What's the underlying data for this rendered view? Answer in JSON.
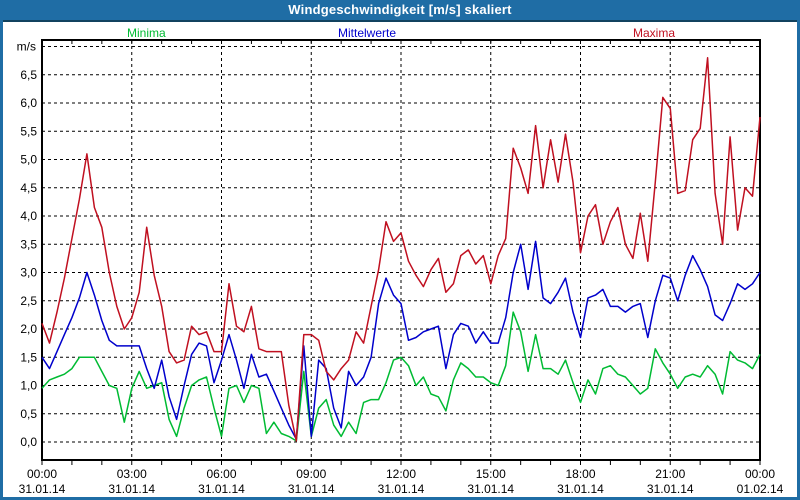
{
  "header": {
    "title": "Windgeschwindigkeit [m/s] skaliert"
  },
  "colors": {
    "frame_border": "#1f6da5",
    "titlebar_bg": "#1f6da5",
    "titlebar_edge": "#11425f",
    "axis": "#000000",
    "grid": "#000000"
  },
  "chart_data": {
    "type": "line",
    "title": "Windgeschwindigkeit [m/s] skaliert",
    "ylabel": "m/s",
    "ylim": [
      0,
      7
    ],
    "y_tick_step": 0.5,
    "y_tick_labels": [
      "0,0",
      "0,5",
      "1,0",
      "1,5",
      "2,0",
      "2,5",
      "3,0",
      "3,5",
      "4,0",
      "4,5",
      "5,0",
      "5,5",
      "6,0",
      "6,5"
    ],
    "x_hours_span": 24,
    "x_step_hours": 0.25,
    "grid": "dashed",
    "legend_position": "top",
    "x_ticks": [
      {
        "time": "00:00",
        "date": "31.01.14",
        "hour": 0
      },
      {
        "time": "03:00",
        "date": "31.01.14",
        "hour": 3
      },
      {
        "time": "06:00",
        "date": "31.01.14",
        "hour": 6
      },
      {
        "time": "09:00",
        "date": "31.01.14",
        "hour": 9
      },
      {
        "time": "12:00",
        "date": "31.01.14",
        "hour": 12
      },
      {
        "time": "15:00",
        "date": "31.01.14",
        "hour": 15
      },
      {
        "time": "18:00",
        "date": "31.01.14",
        "hour": 18
      },
      {
        "time": "21:00",
        "date": "31.01.14",
        "hour": 21
      },
      {
        "time": "00:00",
        "date": "01.02.14",
        "hour": 24
      }
    ],
    "series": [
      {
        "name": "Minima",
        "color": "#00bb33",
        "values": [
          0.95,
          1.1,
          1.15,
          1.2,
          1.3,
          1.5,
          1.5,
          1.5,
          1.25,
          1.0,
          0.95,
          0.35,
          0.95,
          1.25,
          0.95,
          1.0,
          1.05,
          0.4,
          0.1,
          0.6,
          1.0,
          1.1,
          1.15,
          0.6,
          0.1,
          0.95,
          1.0,
          0.7,
          1.0,
          0.95,
          0.15,
          0.35,
          0.15,
          0.1,
          0.02,
          1.25,
          0.1,
          0.6,
          0.75,
          0.3,
          0.1,
          0.35,
          0.15,
          0.7,
          0.75,
          0.75,
          1.05,
          1.45,
          1.5,
          1.35,
          1.0,
          1.15,
          0.85,
          0.8,
          0.55,
          1.1,
          1.4,
          1.3,
          1.15,
          1.15,
          1.05,
          1.0,
          1.35,
          2.3,
          1.95,
          1.25,
          1.9,
          1.3,
          1.3,
          1.2,
          1.45,
          1.05,
          0.7,
          1.1,
          0.85,
          1.3,
          1.35,
          1.2,
          1.15,
          1.0,
          0.85,
          0.95,
          1.65,
          1.4,
          1.2,
          0.95,
          1.15,
          1.2,
          1.15,
          1.35,
          1.2,
          0.85,
          1.6,
          1.45,
          1.4,
          1.3,
          1.55
        ]
      },
      {
        "name": "Mittelwerte",
        "color": "#0000cc",
        "values": [
          1.5,
          1.3,
          1.6,
          1.9,
          2.2,
          2.55,
          3.0,
          2.6,
          2.15,
          1.8,
          1.7,
          1.7,
          1.7,
          1.7,
          1.3,
          0.95,
          1.45,
          0.8,
          0.4,
          1.0,
          1.55,
          1.75,
          1.7,
          1.05,
          1.45,
          1.9,
          1.45,
          0.95,
          1.55,
          1.15,
          1.2,
          0.9,
          0.6,
          0.3,
          0.05,
          1.7,
          0.1,
          1.45,
          1.3,
          0.6,
          0.25,
          1.25,
          1.0,
          1.15,
          1.5,
          2.45,
          2.9,
          2.6,
          2.45,
          1.8,
          1.85,
          1.95,
          2.0,
          2.05,
          1.3,
          1.9,
          2.1,
          2.05,
          1.75,
          1.95,
          1.75,
          1.75,
          2.2,
          3.0,
          3.5,
          2.7,
          3.55,
          2.55,
          2.45,
          2.65,
          2.9,
          2.3,
          1.85,
          2.55,
          2.6,
          2.7,
          2.4,
          2.4,
          2.3,
          2.4,
          2.45,
          1.85,
          2.5,
          2.95,
          2.9,
          2.5,
          2.95,
          3.3,
          3.05,
          2.75,
          2.25,
          2.15,
          2.45,
          2.8,
          2.7,
          2.8,
          3.0
        ]
      },
      {
        "name": "Maxima",
        "color": "#c01020",
        "values": [
          2.1,
          1.75,
          2.3,
          2.9,
          3.6,
          4.3,
          5.1,
          4.15,
          3.8,
          3.0,
          2.4,
          2.0,
          2.2,
          2.65,
          3.8,
          2.95,
          2.4,
          1.6,
          1.4,
          1.45,
          2.05,
          1.9,
          1.95,
          1.6,
          1.6,
          2.8,
          2.05,
          1.95,
          2.4,
          1.65,
          1.6,
          1.6,
          1.6,
          0.65,
          0.02,
          1.9,
          1.9,
          1.8,
          1.25,
          1.1,
          1.3,
          1.45,
          1.95,
          1.75,
          2.4,
          3.05,
          3.9,
          3.55,
          3.7,
          3.2,
          2.95,
          2.75,
          3.05,
          3.25,
          2.65,
          2.8,
          3.3,
          3.4,
          3.15,
          3.3,
          2.8,
          3.3,
          3.6,
          5.2,
          4.85,
          4.4,
          5.6,
          4.5,
          5.35,
          4.6,
          5.45,
          4.6,
          3.35,
          4.0,
          4.2,
          3.5,
          3.9,
          4.15,
          3.5,
          3.25,
          4.05,
          3.2,
          4.6,
          6.1,
          5.9,
          4.4,
          4.45,
          5.35,
          5.55,
          6.8,
          4.4,
          3.5,
          5.4,
          3.75,
          4.5,
          4.35,
          5.75
        ]
      }
    ]
  }
}
